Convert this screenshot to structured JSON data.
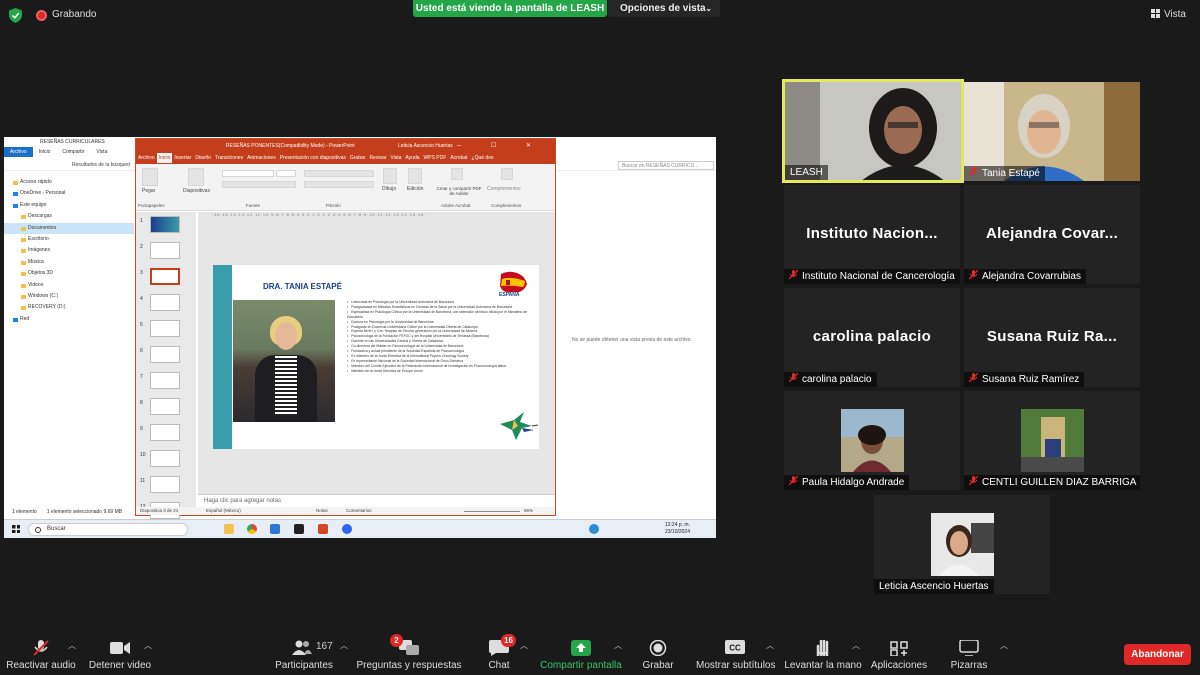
{
  "top": {
    "recording_label": "Grabando",
    "share_banner": "Usted está viendo la pantalla de LEASH",
    "view_options": "Opciones de vista",
    "view_label": "Vista"
  },
  "shared_screen": {
    "explorer": {
      "title": "RESEÑAS CURRICULARES",
      "tabs": [
        "Archivo",
        "Inicio",
        "Compartir",
        "Vista"
      ],
      "address": "Resultados de la búsqued",
      "search_placeholder": "Buscar en RESEÑAS CURRICU...",
      "nav": [
        {
          "label": "Acceso rápido",
          "sub": false
        },
        {
          "label": "OneDrive - Personal",
          "sub": false
        },
        {
          "label": "Este equipo",
          "sub": false
        },
        {
          "label": "Descargas",
          "sub": true
        },
        {
          "label": "Documentos",
          "sub": true
        },
        {
          "label": "Escritorio",
          "sub": true
        },
        {
          "label": "Imágenes",
          "sub": true
        },
        {
          "label": "Música",
          "sub": true
        },
        {
          "label": "Objetos 3D",
          "sub": true
        },
        {
          "label": "Videos",
          "sub": true
        },
        {
          "label": "Windows (C:)",
          "sub": true
        },
        {
          "label": "RECOVERY (D:)",
          "sub": true
        },
        {
          "label": "Red",
          "sub": false
        }
      ],
      "preview_text": "No se puede obtener una vista previa de este archivo.",
      "status_count": "1 elemento",
      "status_selected": "1 elemento seleccionado  9.69 MB"
    },
    "powerpoint": {
      "title": "RESEÑAS  PONENTES(Compatibility Mode)  -  PowerPoint",
      "user": "Leticia Ascencio Huertas",
      "menu": [
        "Archivo",
        "Inicio",
        "Insertar",
        "Diseño",
        "Transiciones",
        "Animaciones",
        "Presentación con diapositivas",
        "Grabar",
        "Revisar",
        "Vista",
        "Ayuda",
        "WPS PDF",
        "Acrobat",
        "¿Qué des"
      ],
      "ribbon": {
        "paste": "Pegar",
        "slides": "Diapositivas",
        "drawing": "Dibujo",
        "editing": "Edición",
        "share_pdf": "Crear y compartir PDF de Adobe",
        "addins": "Complementos",
        "groups": [
          "Portapapeles",
          "Fuente",
          "Párrafo",
          "Adobe Acrobat",
          "Complementos"
        ]
      },
      "thumb_numbers": [
        "1",
        "2",
        "3",
        "4",
        "5",
        "6",
        "7",
        "8",
        "9",
        "10",
        "11",
        "12"
      ],
      "slide": {
        "name": "DRA. TANIA ESTAPÉ",
        "flag_label": "ESPAÑA",
        "bullets": [
          "Licenciada en Psicología por la Universidad Autónoma de Barcelona",
          "Postgraduada en Métodos Estadísticos en Ciencias de la Salud por la Universidad Autónoma de Barcelona",
          "Especialista en Psicología Clínica por la Universidad de Barcelona, con obtención del título oficial por el Ministerio de Educación",
          "Doctora en Psicología por la Universidad de Barcelona",
          "Postgrado en Docencia Universitaria Online por la Universidad Oberta de Catalunya",
          "Experta Nivel I y II en Terapias de Tercera generación por la Universidad de Almería",
          "Psicooncóloga de la Fundación FEFOC y del Hospital Universitario de Terrassa (Barcelona)",
          "Docente en las Universidades Central y Oberta de Catalunya",
          "Co-directora del Máster en Psicooncología de la Universidad de Barcelona",
          "Fundadora y actual presidente de la Sociedad Española de Psicooncología",
          "Ex miembro de la Junta Directiva de la International Psycho-Oncology Society",
          "Ex representante Nacional de la Sociedad Internacional de Onco-Geriatría",
          "Miembro del Comité Ejecutivo de la Federación Internacional de Investigación en Psicooncología latina",
          "Miembro de la Junta Directiva de Europe Uomo"
        ]
      },
      "notes_placeholder": "Haga clic para agregar notas",
      "status": {
        "slide_of": "Diapositiva 3 de 21",
        "language": "Español (México)",
        "notes": "Notas",
        "comments": "Comentarios",
        "zoom": "56%"
      }
    },
    "taskbar": {
      "search": "Buscar",
      "time": "12:24 p. m.",
      "date": "23/10/2024"
    }
  },
  "participants": [
    {
      "name": "LEASH",
      "display": "",
      "muted": false,
      "type": "video-leash"
    },
    {
      "name": "Tania Estapé",
      "display": "",
      "muted": true,
      "type": "video-tania"
    },
    {
      "name": "Instituto Nacional de Cancerología",
      "display": "Instituto  Nacion...",
      "muted": true,
      "type": "text"
    },
    {
      "name": "Alejandra Covarrubias",
      "display": "Alejandra  Covar...",
      "muted": true,
      "type": "text"
    },
    {
      "name": "carolina palacio",
      "display": "carolina palacio",
      "muted": true,
      "type": "text"
    },
    {
      "name": "Susana Ruiz Ramírez",
      "display": "Susana  Ruiz  Ra...",
      "muted": true,
      "type": "text"
    },
    {
      "name": "Paula Hidalgo Andrade",
      "display": "",
      "muted": true,
      "type": "avatar-paula"
    },
    {
      "name": "CENTLI GUILLEN DIAZ BARRIGA",
      "display": "",
      "muted": true,
      "type": "avatar-centli"
    },
    {
      "name": "Leticia Ascencio Huertas",
      "display": "",
      "muted": false,
      "type": "avatar-leticia"
    }
  ],
  "toolbar": {
    "unmute": "Reactivar audio",
    "stop_video": "Detener video",
    "participants": "Participantes",
    "participants_count": "167",
    "qa": "Preguntas y respuestas",
    "qa_badge": "2",
    "chat": "Chat",
    "chat_badge": "16",
    "share": "Compartir pantalla",
    "record": "Grabar",
    "captions": "Mostrar subtítulos",
    "raise_hand": "Levantar la mano",
    "apps": "Aplicaciones",
    "whiteboards": "Pizarras",
    "leave": "Abandonar"
  },
  "colors": {
    "share_green": "#23a548",
    "leave_red": "#e02828",
    "active_speaker": "#e3e85c",
    "ppt_red": "#c43e1c"
  }
}
